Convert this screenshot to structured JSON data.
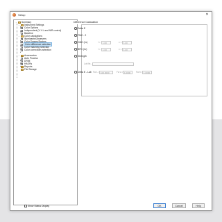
{
  "window": {
    "title": "Setup",
    "close_glyph": "✕"
  },
  "tree": {
    "items": [
      {
        "label": "Summary",
        "icon": "folder-icon"
      },
      {
        "label": "Instrument Settings",
        "icon": "folder-icon"
      },
      {
        "label": "Color Options",
        "icon": "leaf-icon"
      },
      {
        "label": "Independent (X-Y-L and NIR control)",
        "icon": "leaf-icon"
      },
      {
        "label": "Baseline",
        "icon": "leaf-icon"
      },
      {
        "label": "Color calculations",
        "icon": "folder-icon"
      },
      {
        "label": "Illuminants/Observers",
        "icon": "leaf-icon"
      },
      {
        "label": "Color Spaces/Scalers",
        "icon": "leaf-icon"
      },
      {
        "label": "Color difference selection",
        "icon": "leaf-icon"
      },
      {
        "label": "Color matching selection",
        "icon": "leaf-icon"
      },
      {
        "label": "Color corrections selection",
        "icon": "leaf-icon"
      },
      {
        "label": "Accessories",
        "icon": "folder-icon"
      },
      {
        "label": "Auto Process",
        "icon": "leaf-icon"
      },
      {
        "label": "DRMI",
        "icon": "leaf-icon"
      },
      {
        "label": "HAGRs",
        "icon": "leaf-icon"
      },
      {
        "label": "Reports",
        "icon": "folder-icon"
      },
      {
        "label": "File Storage",
        "icon": "folder-icon"
      }
    ]
  },
  "difference": {
    "group_title": "Difference Calculation",
    "options": [
      {
        "label": "Delta E"
      },
      {
        "label": "FMC - 2"
      },
      {
        "label": "CMC (l:c)",
        "params": [
          {
            "label": "l =",
            "value": "1.00"
          },
          {
            "label": "c =",
            "value": "1.00"
          }
        ]
      },
      {
        "label": "BFD (l:c)",
        "params": [
          {
            "label": "l =",
            "value": "1.00"
          },
          {
            "label": "c =",
            "value": "1.00"
          }
        ]
      },
      {
        "label": "Strength"
      },
      {
        "label": "Delta E - Lab",
        "params": [
          {
            "label": "Fw L =",
            "value": "100.0000"
          },
          {
            "label": "Fw a =",
            "value": "1.0000"
          },
          {
            "label": "Fw b =",
            "value": "1.0000"
          }
        ]
      }
    ],
    "strength_sub_label": "Lot file..."
  },
  "footer": {
    "show_status_label": "Show Status Display",
    "ok_label": "OK",
    "cancel_label": "Cancel",
    "help_label": "Help"
  }
}
